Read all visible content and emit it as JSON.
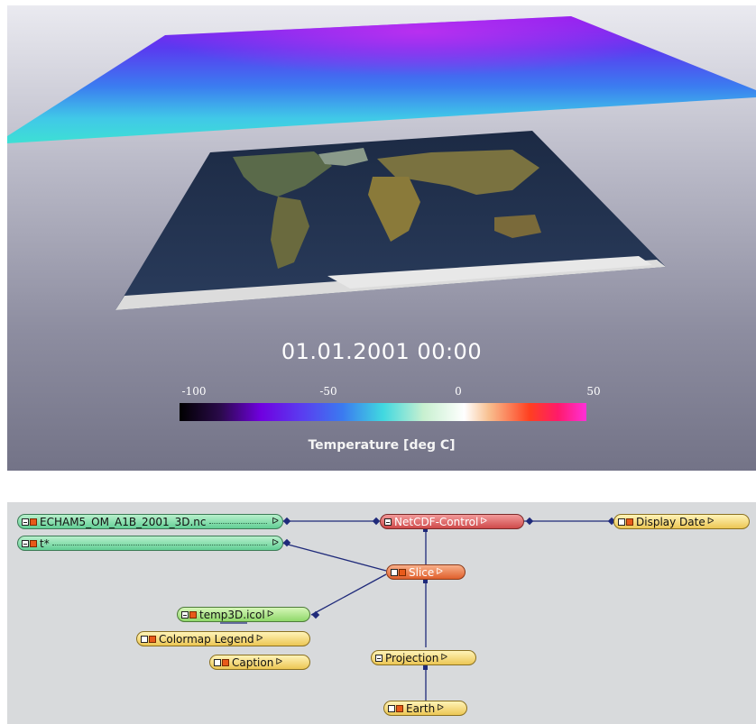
{
  "viewport": {
    "timestamp": "01.01.2001  00:00",
    "colorbar": {
      "ticks": [
        "-100",
        "-50",
        "0",
        "50"
      ],
      "label": "Temperature [deg C]"
    }
  },
  "network": {
    "nodes": {
      "echam": "ECHAM5_OM_A1B_2001_3D.nc",
      "t": "t*",
      "netcdf": "NetCDF-Control",
      "display_date": "Display Date",
      "slice": "Slice",
      "temp3d": "temp3D.icol",
      "colormap_legend": "Colormap Legend",
      "caption": "Caption",
      "projection": "Projection",
      "earth": "Earth"
    },
    "port_arrow": "ᐅ"
  },
  "colors": {
    "wire": "#1f2a7a",
    "editor_bg": "#d8dadc"
  }
}
